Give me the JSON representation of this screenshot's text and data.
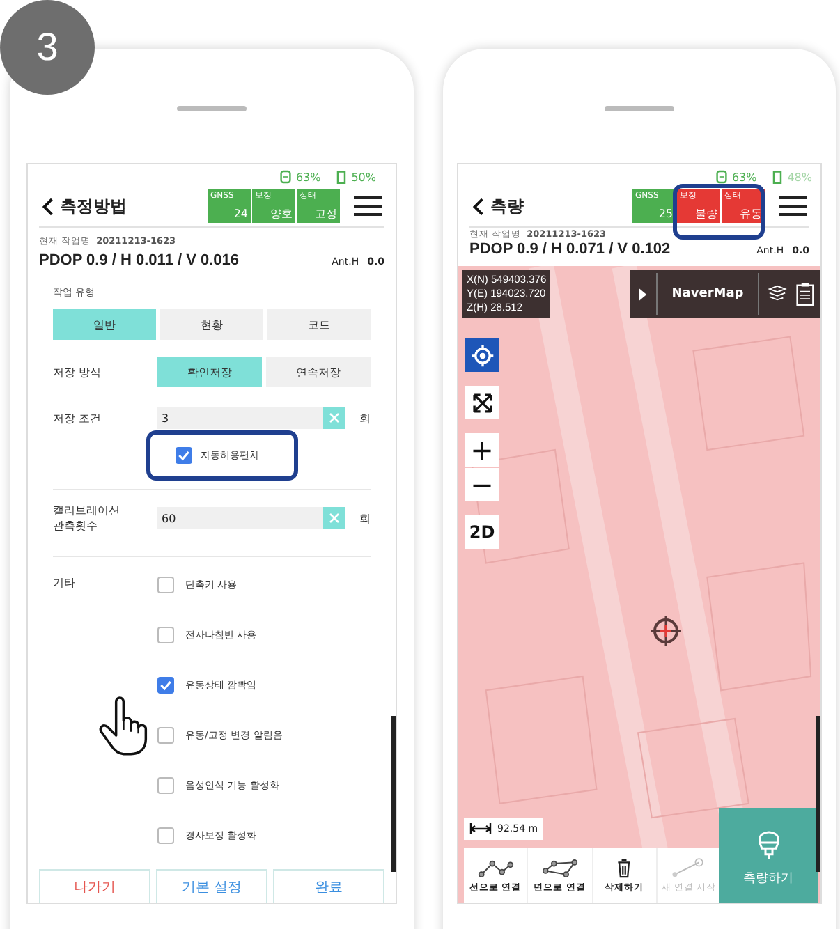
{
  "step_badge": "3",
  "left_phone": {
    "status": {
      "gps": "63%",
      "battery": "50%"
    },
    "title": "측정방법",
    "gnss": [
      {
        "label": "GNSS",
        "value": "24",
        "color": "#4caf50"
      },
      {
        "label": "보정",
        "value": "양호",
        "color": "#4caf50"
      },
      {
        "label": "상태",
        "value": "고정",
        "color": "#4caf50"
      }
    ],
    "job_label": "현재 작업명",
    "job_name": "20211213-1623",
    "precision": "PDOP 0.9 / H 0.011 / V 0.016",
    "ant_label": "Ant.H",
    "ant_value": "0.0",
    "work_type": {
      "label": "작업 유형",
      "options": [
        {
          "label": "일반",
          "selected": true
        },
        {
          "label": "현황",
          "selected": false
        },
        {
          "label": "코드",
          "selected": false
        }
      ]
    },
    "save_mode": {
      "label": "저장 방식",
      "options": [
        {
          "label": "확인저장",
          "selected": true
        },
        {
          "label": "연속저장",
          "selected": false
        }
      ]
    },
    "save_condition": {
      "label": "저장 조건",
      "value": "3",
      "unit": "회"
    },
    "auto_tolerance": {
      "label": "자동허용편차",
      "checked": true,
      "highlighted": true
    },
    "calibration": {
      "label_lines": [
        "캘리브레이션",
        "관측횟수"
      ],
      "value": "60",
      "unit": "회"
    },
    "other": {
      "label": "기타",
      "options": [
        {
          "label": "단축키 사용",
          "checked": false
        },
        {
          "label": "전자나침반 사용",
          "checked": false
        },
        {
          "label": "유동상태 깜빡임",
          "checked": true
        },
        {
          "label": "유동/고정 변경 알림음",
          "checked": false
        },
        {
          "label": "음성인식 기능 활성화",
          "checked": false
        },
        {
          "label": "경사보정 활성화",
          "checked": false
        }
      ]
    },
    "footer": [
      {
        "label": "나가기",
        "kind": "exit"
      },
      {
        "label": "기본 설정",
        "kind": "default"
      },
      {
        "label": "완료",
        "kind": "done"
      }
    ]
  },
  "right_phone": {
    "status": {
      "gps": "63%",
      "battery": "48%"
    },
    "title": "측량",
    "gnss": [
      {
        "label": "GNSS",
        "value": "25",
        "color": "#4caf50"
      },
      {
        "label": "보정",
        "value": "불량",
        "color": "#e53935"
      },
      {
        "label": "상태",
        "value": "유동",
        "color": "#e53935"
      }
    ],
    "status_highlight": true,
    "job_label": "현재 작업명",
    "job_name": "20211213-1623",
    "precision": "PDOP 0.9 / H 0.071 / V 0.102",
    "ant_label": "Ant.H",
    "ant_value": "0.0",
    "coordinates": [
      "X(N) 549403.376",
      "Y(E) 194023.720",
      "Z(H) 28.512"
    ],
    "map_layer": "NaverMap",
    "zoom_in": "+",
    "zoom_out": "−",
    "view_mode": "2D",
    "scale": "92.54 m",
    "tools": [
      {
        "label": "선으로 연결",
        "kind": "line",
        "disabled": false
      },
      {
        "label": "면으로 연결",
        "kind": "polygon",
        "disabled": false
      },
      {
        "label": "삭제하기",
        "kind": "delete",
        "disabled": false
      },
      {
        "label": "새 연결 시작",
        "kind": "new",
        "disabled": true
      }
    ],
    "measure_button": "측량하기"
  }
}
